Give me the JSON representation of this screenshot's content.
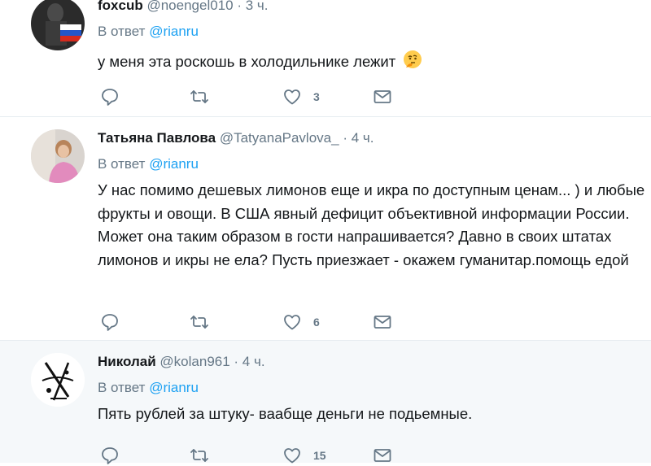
{
  "tweets": [
    {
      "name": "foxcub",
      "handle": "@noengel010",
      "time": "· 3 ч.",
      "reply_prefix": "В ответ",
      "reply_to": "@rianru",
      "text": "у меня эта роскошь в холодильнике лежит",
      "emoji": "thinking-face",
      "likes": "3"
    },
    {
      "name": "Татьяна Павлова",
      "handle": "@TatyanaPavlova_",
      "time": "· 4 ч.",
      "reply_prefix": "В ответ",
      "reply_to": "@rianru",
      "text": "У нас помимо дешевых лимонов еще и икра по доступным ценам... ) и любые фрукты и овощи. В США явный дефицит объективной информации России. Может она таким образом в гости напрашивается? Давно в своих штатах лимонов и икры не ела? Пусть приезжает - окажем гуманитар.помощь едой",
      "likes": "6"
    },
    {
      "name": "Николай",
      "handle": "@kolan961",
      "time": "· 4 ч.",
      "reply_prefix": "В ответ",
      "reply_to": "@rianru",
      "text": "Пять рублей за штуку- ваабще деньги не подьемные.",
      "likes": "15"
    }
  ],
  "colors": {
    "link": "#1da1f2",
    "meta": "#657786",
    "text": "#14171a",
    "highlight_bg": "#f5f8fa",
    "separator": "#e6ecf0"
  },
  "icons": [
    "reply-icon",
    "retweet-icon",
    "like-icon",
    "message-icon"
  ]
}
